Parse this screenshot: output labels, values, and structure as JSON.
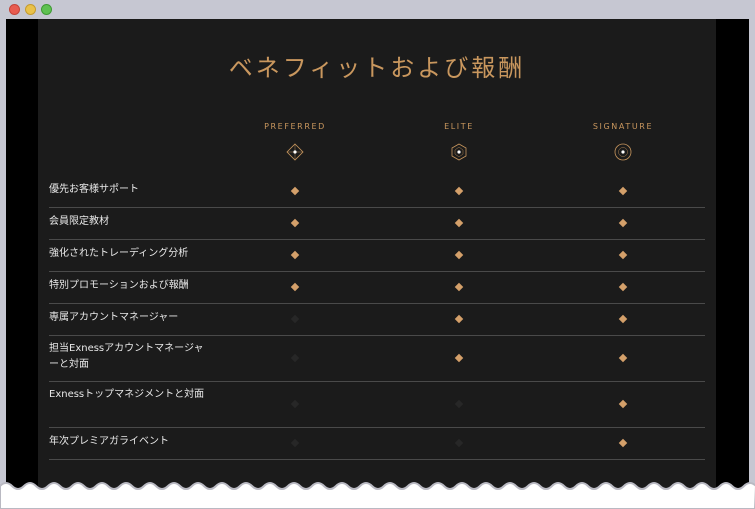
{
  "page": {
    "title": "ベネフィットおよび報酬"
  },
  "tiers": [
    {
      "name": "PREFERRED",
      "icon": "diamond-dot-icon"
    },
    {
      "name": "ELITE",
      "icon": "hexagon-dot-icon"
    },
    {
      "name": "SIGNATURE",
      "icon": "circle-dot-icon"
    }
  ],
  "benefits": [
    {
      "label": "優先お客様サポート",
      "available": [
        true,
        true,
        true
      ]
    },
    {
      "label": "会員限定教材",
      "available": [
        true,
        true,
        true
      ]
    },
    {
      "label": "強化されたトレーディング分析",
      "available": [
        true,
        true,
        true
      ]
    },
    {
      "label": "特別プロモーションおよび報酬",
      "available": [
        true,
        true,
        true
      ]
    },
    {
      "label": "専属アカウントマネージャー",
      "available": [
        false,
        true,
        true
      ]
    },
    {
      "label": "担当Exnessアカウントマネージャーと対面",
      "available": [
        false,
        true,
        true
      ]
    },
    {
      "label": "Exnessトップマネジメントと対面",
      "available": [
        false,
        false,
        true
      ]
    },
    {
      "label": "年次プレミアガライベント",
      "available": [
        false,
        false,
        true
      ]
    }
  ],
  "colors": {
    "accent": "#c9975e",
    "panel": "#1b1b1b",
    "divider": "#4a4a4a"
  }
}
